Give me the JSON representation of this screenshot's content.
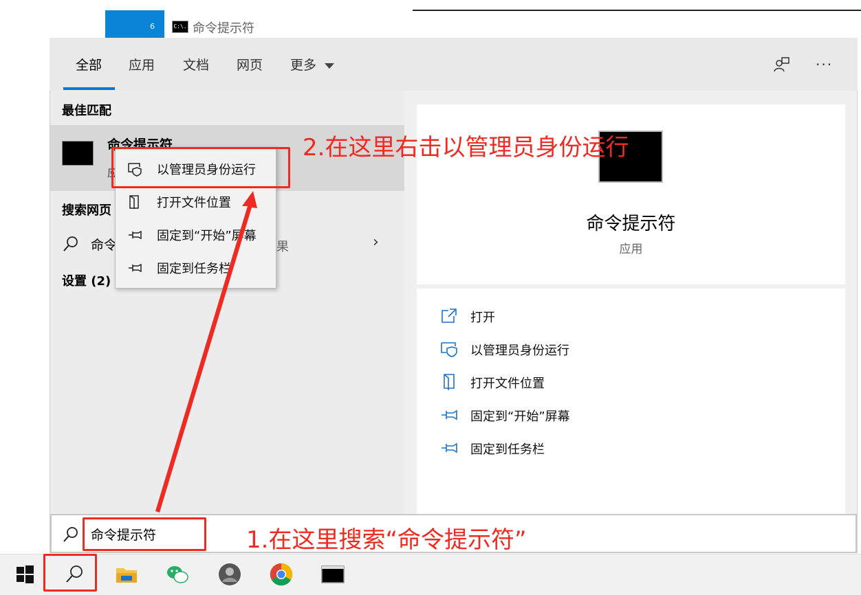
{
  "background_window": {
    "badge_number": "6",
    "title": "命令提示符",
    "title_icon_text": "C:\\."
  },
  "tabs": {
    "all": "全部",
    "apps": "应用",
    "docs": "文档",
    "web": "网页",
    "more": "更多"
  },
  "left": {
    "best_match_label": "最佳匹配",
    "best_match_title": "命令提示符",
    "best_match_sub": "应",
    "search_web_label": "搜索网页",
    "search_web_text": "命令",
    "search_web_tail": "果",
    "settings_label": "设置 (2)"
  },
  "context_menu": {
    "items": [
      "以管理员身份运行",
      "打开文件位置",
      "固定到“开始”屏幕",
      "固定到任务栏"
    ]
  },
  "preview": {
    "title": "命令提示符",
    "subtitle": "应用",
    "actions": [
      "打开",
      "以管理员身份运行",
      "打开文件位置",
      "固定到“开始”屏幕",
      "固定到任务栏"
    ]
  },
  "search": {
    "value": "命令提示符"
  },
  "annotations": {
    "step1": "1.在这里搜索“命令提示符”",
    "step2": "2.在这里右击以管理员身份运行"
  },
  "taskbar": {
    "icons": [
      "windows-start-icon",
      "search-icon",
      "file-explorer-icon",
      "wechat-icon",
      "avatar-app-icon",
      "chrome-icon",
      "command-prompt-icon"
    ]
  },
  "colors": {
    "accent": "#0078d7",
    "annotation_red": "#ee2b22"
  }
}
